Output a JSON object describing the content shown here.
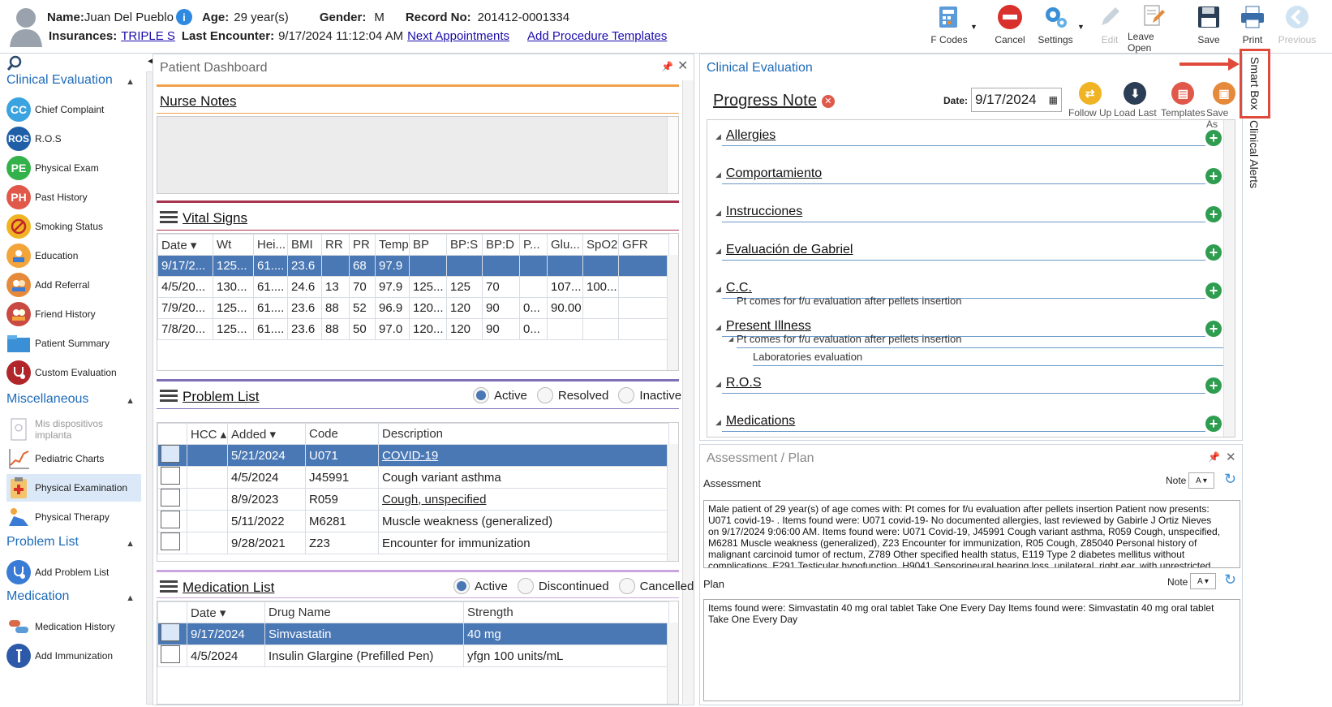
{
  "header": {
    "name_label": "Name:",
    "name": "Juan Del Pueblo",
    "age_label": "Age:",
    "age": "29 year(s)",
    "gender_label": "Gender:",
    "gender": "M",
    "record_label": "Record No:",
    "record": "201412-0001334",
    "insurances_label": "Insurances:",
    "insurance": "TRIPLE S",
    "last_encounter_label": "Last Encounter:",
    "last_encounter": "9/17/2024 11:12:04 AM",
    "next_appointments": "Next Appointments",
    "add_procedure_templates": "Add Procedure Templates"
  },
  "toolbar": {
    "fcodes": "F Codes",
    "cancel": "Cancel",
    "settings": "Settings",
    "edit": "Edit",
    "leave_open": "Leave Open",
    "save": "Save",
    "print": "Print",
    "previous": "Previous"
  },
  "sidebar": {
    "sections": [
      {
        "title": "Clinical Evaluation"
      },
      {
        "title": "Miscellaneous"
      },
      {
        "title": "Problem List"
      },
      {
        "title": "Medication"
      }
    ],
    "items": [
      {
        "label": "Chief Complaint",
        "abbr": "CC",
        "color": "#3aa3e0"
      },
      {
        "label": "R.O.S",
        "abbr": "ROS",
        "color": "#1e5fa8"
      },
      {
        "label": "Physical Exam",
        "abbr": "PE",
        "color": "#33b14b"
      },
      {
        "label": "Past History",
        "abbr": "PH",
        "color": "#e0584a"
      },
      {
        "label": "Smoking Status",
        "abbr": "",
        "color": "#f0b323"
      },
      {
        "label": "Education",
        "abbr": "",
        "color": "#f3a43b"
      },
      {
        "label": "Add Referral",
        "abbr": "",
        "color": "#e58a3a"
      },
      {
        "label": "Friend History",
        "abbr": "",
        "color": "#c94a42"
      },
      {
        "label": "Patient Summary",
        "abbr": "",
        "color": "#3a8fd6"
      },
      {
        "label": "Custom Evaluation",
        "abbr": "",
        "color": "#b0262a"
      },
      {
        "label": "Mis dispositivos implanta",
        "abbr": "",
        "color": "#9ab"
      },
      {
        "label": "Pediatric Charts",
        "abbr": "",
        "color": "#e4632f"
      },
      {
        "label": "Physical Examination",
        "abbr": "",
        "color": "#f3a43b"
      },
      {
        "label": "Physical Therapy",
        "abbr": "",
        "color": "#3a7bd6"
      },
      {
        "label": "Add Problem List",
        "abbr": "",
        "color": "#3a7bd6"
      },
      {
        "label": "Medication History",
        "abbr": "",
        "color": "#d86a4a"
      },
      {
        "label": "Add Immunization",
        "abbr": "",
        "color": "#2d5aa8"
      }
    ]
  },
  "dashboard": {
    "title": "Patient Dashboard",
    "nurse_notes": "Nurse Notes",
    "vital_signs": "Vital Signs",
    "vitals_headers": [
      "Date",
      "Wt",
      "Hei...",
      "BMI",
      "RR",
      "PR",
      "Temp",
      "BP",
      "BP:S",
      "BP:D",
      "P...",
      "Glu...",
      "SpO2",
      "GFR"
    ],
    "vitals_rows": [
      [
        "9/17/2...",
        "125...",
        "61....",
        "23.6",
        "",
        "68",
        "97.9",
        "",
        "",
        "",
        "",
        "",
        "",
        ""
      ],
      [
        "4/5/20...",
        "130...",
        "61....",
        "24.6",
        "13",
        "70",
        "97.9",
        "125...",
        "125",
        "70",
        "",
        "107...",
        "100...",
        ""
      ],
      [
        "7/9/20...",
        "125...",
        "61....",
        "23.6",
        "88",
        "52",
        "96.9",
        "120...",
        "120",
        "90",
        "0...",
        "90.00",
        "",
        ""
      ],
      [
        "7/8/20...",
        "125...",
        "61....",
        "23.6",
        "88",
        "50",
        "97.0",
        "120...",
        "120",
        "90",
        "0...",
        "",
        "",
        ""
      ]
    ],
    "problem_list": "Problem List",
    "problem_filters": [
      "Active",
      "Resolved",
      "Inactive"
    ],
    "problem_headers": [
      "",
      "HCC",
      "Added",
      "Code",
      "Description"
    ],
    "problem_rows": [
      [
        "",
        "",
        "5/21/2024",
        "U071",
        "COVID-19"
      ],
      [
        "",
        "",
        "4/5/2024",
        "J45991",
        "Cough variant asthma"
      ],
      [
        "",
        "",
        "8/9/2023",
        "R059",
        "Cough, unspecified"
      ],
      [
        "",
        "",
        "5/11/2022",
        "M6281",
        "Muscle weakness (generalized)"
      ],
      [
        "",
        "",
        "9/28/2021",
        "Z23",
        "Encounter for immunization"
      ]
    ],
    "medication_list": "Medication List",
    "med_filters": [
      "Active",
      "Discontinued",
      "Cancelled"
    ],
    "med_headers": [
      "",
      "Date",
      "Drug Name",
      "Strength"
    ],
    "med_rows": [
      [
        "",
        "9/17/2024",
        "Simvastatin",
        "40 mg"
      ],
      [
        "",
        "4/5/2024",
        "Insulin Glargine (Prefilled Pen)",
        "yfgn 100 units/mL"
      ]
    ]
  },
  "clinical": {
    "title": "Clinical Evaluation",
    "note_title": "Progress Note",
    "date_label": "Date:",
    "date_value": "9/17/2024",
    "tools": [
      "Follow Up",
      "Load Last",
      "Templates",
      "Save As"
    ],
    "sections": [
      "Allergies",
      "Comportamiento",
      "Instrucciones",
      "Evaluación de Gabriel",
      "C.C.",
      "Present Illness",
      "R.O.S",
      "Medications"
    ],
    "cc_text": "Pt comes for f/u evaluation after pellets insertion",
    "pi_text": "Pt comes for f/u evaluation after pellets insertion",
    "pi_sub": "Laboratories evaluation"
  },
  "assessment": {
    "title": "Assessment / Plan",
    "assessment_label": "Assessment",
    "note_label": "Note",
    "assessment_text": "Male patient of 29 year(s) of age comes with:  Pt comes for f/u evaluation after pellets insertion  Patient now presents: U071 covid-19- . Items found were:  U071 covid-19-    No documented allergies, last reviewed by Gabirle J Ortiz Nieves on 9/17/2024 9:06:00 AM.    Items found were:  U071 Covid-19, J45991 Cough variant asthma, R059 Cough, unspecified, M6281 Muscle weakness (generalized), Z23 Encounter for immunization, R05 Cough, Z85040 Personal history of malignant carcinoid tumor of rectum, Z789 Other specified health status, E119 Type 2 diabetes mellitus without complications, E291 Testicular hypofunction, H9041 Sensorineural hearing loss, unilateral, right ear, with unrestricted",
    "plan_label": "Plan",
    "plan_text": "  Items found were:  Simvastatin 40 mg oral tablet Take One Every Day   Items found were:  Simvastatin 40 mg oral tablet Take One Every Day"
  },
  "right_tabs": {
    "smart_box": "Smart Box",
    "clinical_alerts": "Clinical Alerts"
  }
}
